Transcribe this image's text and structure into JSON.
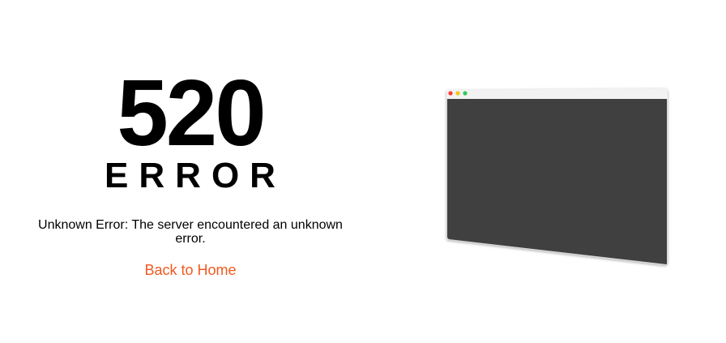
{
  "error": {
    "code": "520",
    "word": "ERROR",
    "message": "Unknown Error: The server encountered an unknown error.",
    "home_link_label": "Back to Home"
  },
  "colors": {
    "link": "#f2591f",
    "screen": "#404040",
    "dot_red": "#ff3b30",
    "dot_yellow": "#f5c518",
    "dot_green": "#34c759"
  },
  "illustration": {
    "icon": "browser-window-icon"
  }
}
